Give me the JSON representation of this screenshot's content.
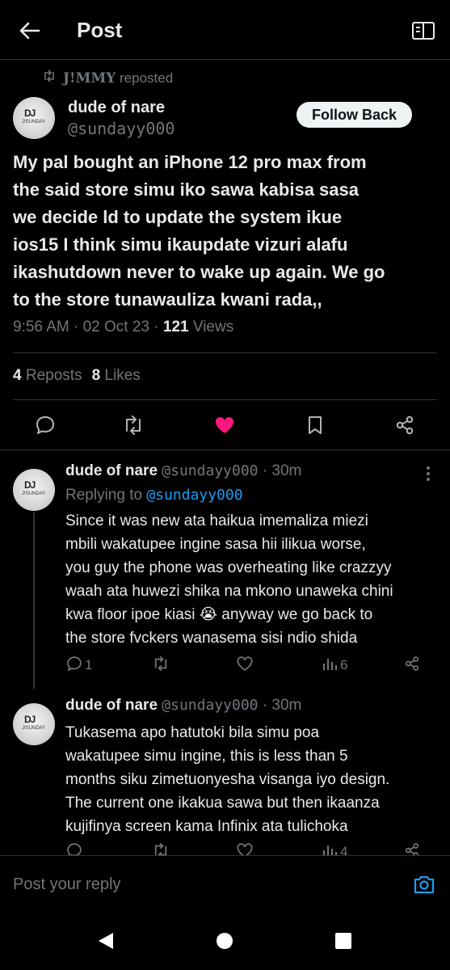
{
  "header": {
    "title": "Post"
  },
  "repost": {
    "who": "J!MMY",
    "label": "reposted"
  },
  "main_post": {
    "author_name": "dude of nare",
    "author_handle": "@sundayy000",
    "avatar_initials": "DJ",
    "avatar_subtitle": "J!SUNDAY",
    "follow_label": "Follow Back",
    "body_lines": [
      "My pal bought an iPhone 12 pro max from",
      "the said store simu iko sawa kabisa sasa",
      "we decide ld to update the system ikue",
      "ios15 I think simu ikaupdate vizuri alafu",
      "ikashutdown never to wake up again. We go",
      "to the store tunawauliza kwani rada,,"
    ],
    "time": "9:56 AM",
    "date": "02 Oct 23",
    "views_count": "121",
    "views_label": "Views",
    "reposts_count": "4",
    "reposts_label": "Reposts",
    "likes_count": "8",
    "likes_label": "Likes"
  },
  "replies": [
    {
      "author_name": "dude of nare",
      "author_handle": "@sundayy000",
      "time": "30m",
      "replying_label": "Replying to",
      "replying_to": "@sundayy000",
      "text_lines": [
        "Since it was new ata haikua imemaliza miezi",
        "mbili wakatupee ingine sasa hii ilikua worse,",
        "you guy the phone was overheating like crazzyy",
        "waah ata huwezi shika na mkono unaweka chini",
        "kwa floor ipoe kiasi 😭 anyway we go back to",
        "the store fvckers wanasema sisi ndio shida"
      ],
      "reply_count": "1",
      "view_count": "6"
    },
    {
      "author_name": "dude of nare",
      "author_handle": "@sundayy000",
      "time": "30m",
      "text_lines": [
        "Tukasema apo hatutoki bila simu poa",
        "wakatupee simu ingine, this is less than 5",
        "months siku zimetuonyesha visanga iyo design.",
        "The current one ikakua sawa but then ikaanza",
        "kujifinya screen kama Infinix ata tulichoka"
      ],
      "view_count": "4"
    }
  ],
  "composer": {
    "placeholder": "Post your reply"
  },
  "colors": {
    "background": "#000000",
    "text_primary": "#e7e9ea",
    "text_secondary": "#71767b",
    "accent_blue": "#1d9bf0",
    "like_pink": "#f91880",
    "border": "#2f3336"
  }
}
